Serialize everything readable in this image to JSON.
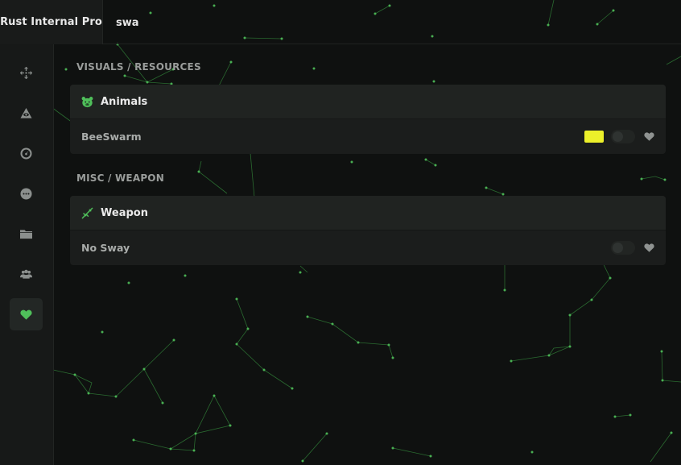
{
  "app": {
    "title": "Rust Internal Pro"
  },
  "search": {
    "value": "swa"
  },
  "sidebar": {
    "items": [
      {
        "icon": "crosshair-icon",
        "active": false
      },
      {
        "icon": "eye-icon",
        "active": false
      },
      {
        "icon": "gauge-icon",
        "active": false
      },
      {
        "icon": "chat-icon",
        "active": false
      },
      {
        "icon": "folder-icon",
        "active": false
      },
      {
        "icon": "users-icon",
        "active": false
      },
      {
        "icon": "heart-icon",
        "active": true
      }
    ]
  },
  "sections": [
    {
      "title": "VISUALS / RESOURCES",
      "card": {
        "title": "Animals",
        "icon": "bear-icon",
        "rows": [
          {
            "label": "BeeSwarm",
            "color": "#ecf02a",
            "enabled": false,
            "favorite": true
          }
        ]
      }
    },
    {
      "title": "MISC / WEAPON",
      "card": {
        "title": "Weapon",
        "icon": "rifle-icon",
        "rows": [
          {
            "label": "No Sway",
            "enabled": false,
            "favorite": true
          }
        ]
      }
    }
  ],
  "theme": {
    "accent": "#4fbf5a",
    "background": "#0f1110",
    "panel": "#1b1d1c",
    "header": "#202321",
    "network_line": "#2f7a36",
    "network_dot": "#4fbf5a"
  }
}
